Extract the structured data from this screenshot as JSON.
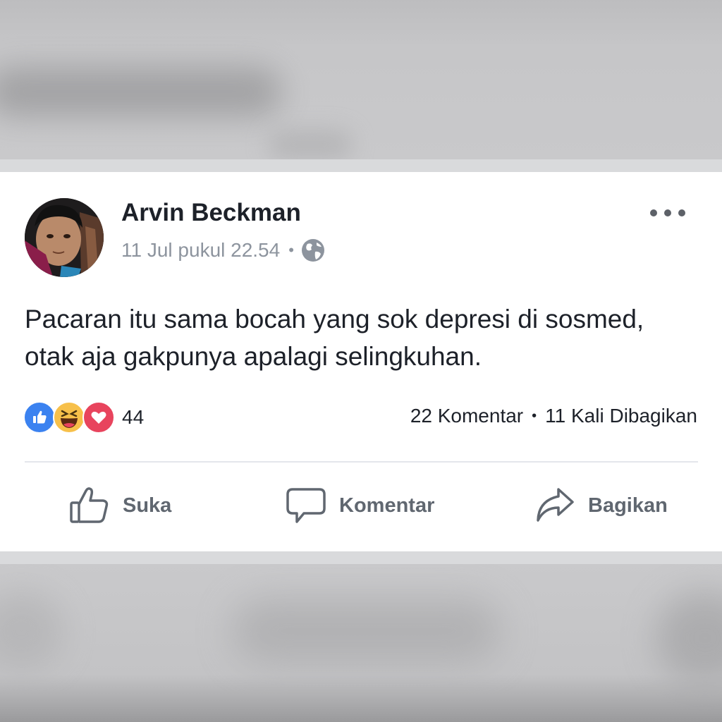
{
  "post": {
    "author": "Arvin Beckman",
    "timestamp": "11 Jul pukul 22.54",
    "privacy_icon": "globe-icon",
    "text_lines": [
      "Pacaran itu sama bocah yang sok depresi di sosmed,",
      "otak aja gakpunya apalagi selingkuhan."
    ],
    "reactions": {
      "icons": [
        "like-reaction-icon",
        "haha-reaction-icon",
        "love-reaction-icon"
      ],
      "count": "44"
    },
    "comments": "22 Komentar",
    "shares": "11 Kali Dibagikan",
    "separator": "•"
  },
  "actions": {
    "like": "Suka",
    "comment": "Komentar",
    "share": "Bagikan"
  },
  "colors": {
    "like_blue": "#3b82f0",
    "haha_yellow": "#f7c04a",
    "love_red": "#e8445d",
    "text_primary": "#1d2129",
    "text_secondary": "#8d949e"
  }
}
